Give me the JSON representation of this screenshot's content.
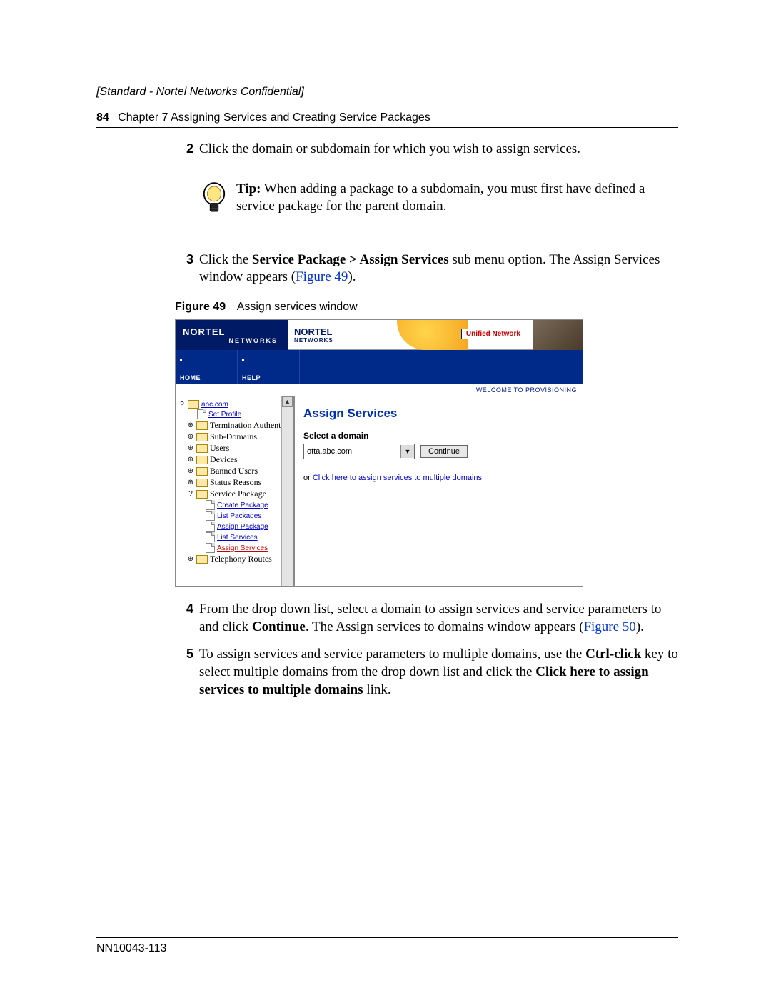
{
  "confidential": "[Standard - Nortel Networks Confidential]",
  "header": {
    "page_num": "84",
    "chapter": "Chapter 7  Assigning Services and Creating Service Packages"
  },
  "step2": {
    "num": "2",
    "text": "Click the domain or subdomain for which you wish to assign services."
  },
  "tip": {
    "label": "Tip:",
    "text": " When adding a package to a subdomain, you must first have defined a service package for the parent domain."
  },
  "step3": {
    "num": "3",
    "pre": "Click the ",
    "bold1": "Service Package > Assign Services",
    "mid": " sub menu option. The Assign Services window appears (",
    "figref": "Figure 49",
    "post": ")."
  },
  "figure": {
    "label": "Figure 49",
    "caption": "Assign services window"
  },
  "screenshot": {
    "brand": "NORTEL",
    "brand_sub": "NETWORKS",
    "brand2": "NORTEL",
    "brand2_sub": "NETWORKS",
    "unified": "Unified Network",
    "menu": {
      "home": "HOME",
      "help": "HELP"
    },
    "welcome": "WELCOME TO PROVISIONING",
    "tree": {
      "root": "abc.com",
      "set_profile": "Set Profile",
      "items": [
        "Termination Authentic",
        "Sub-Domains",
        "Users",
        "Devices",
        "Banned Users",
        "Status Reasons",
        "Service Package"
      ],
      "sp_children": [
        "Create Package",
        "List Packages",
        "Assign Package",
        "List Services",
        "Assign Services"
      ],
      "telephony": "Telephony Routes"
    },
    "main": {
      "title": "Assign Services",
      "select_label": "Select a domain",
      "dropdown_value": "otta.abc.com",
      "continue": "Continue",
      "or": "or ",
      "multi_link": "Click here to assign services to multiple domains"
    }
  },
  "step4": {
    "num": "4",
    "t1": "From the drop down list, select a domain to assign services and service parameters to and click ",
    "b1": "Continue",
    "t2": ". The Assign services to domains window appears (",
    "figref": "Figure 50",
    "t3": ")."
  },
  "step5": {
    "num": "5",
    "t1": "To assign services and service parameters to multiple domains, use the ",
    "b1": "Ctrl-click",
    "t2": " key to select multiple domains from the drop down list and click the ",
    "b2": "Click here to assign services to multiple domains",
    "t3": " link."
  },
  "footer": "NN10043-113"
}
